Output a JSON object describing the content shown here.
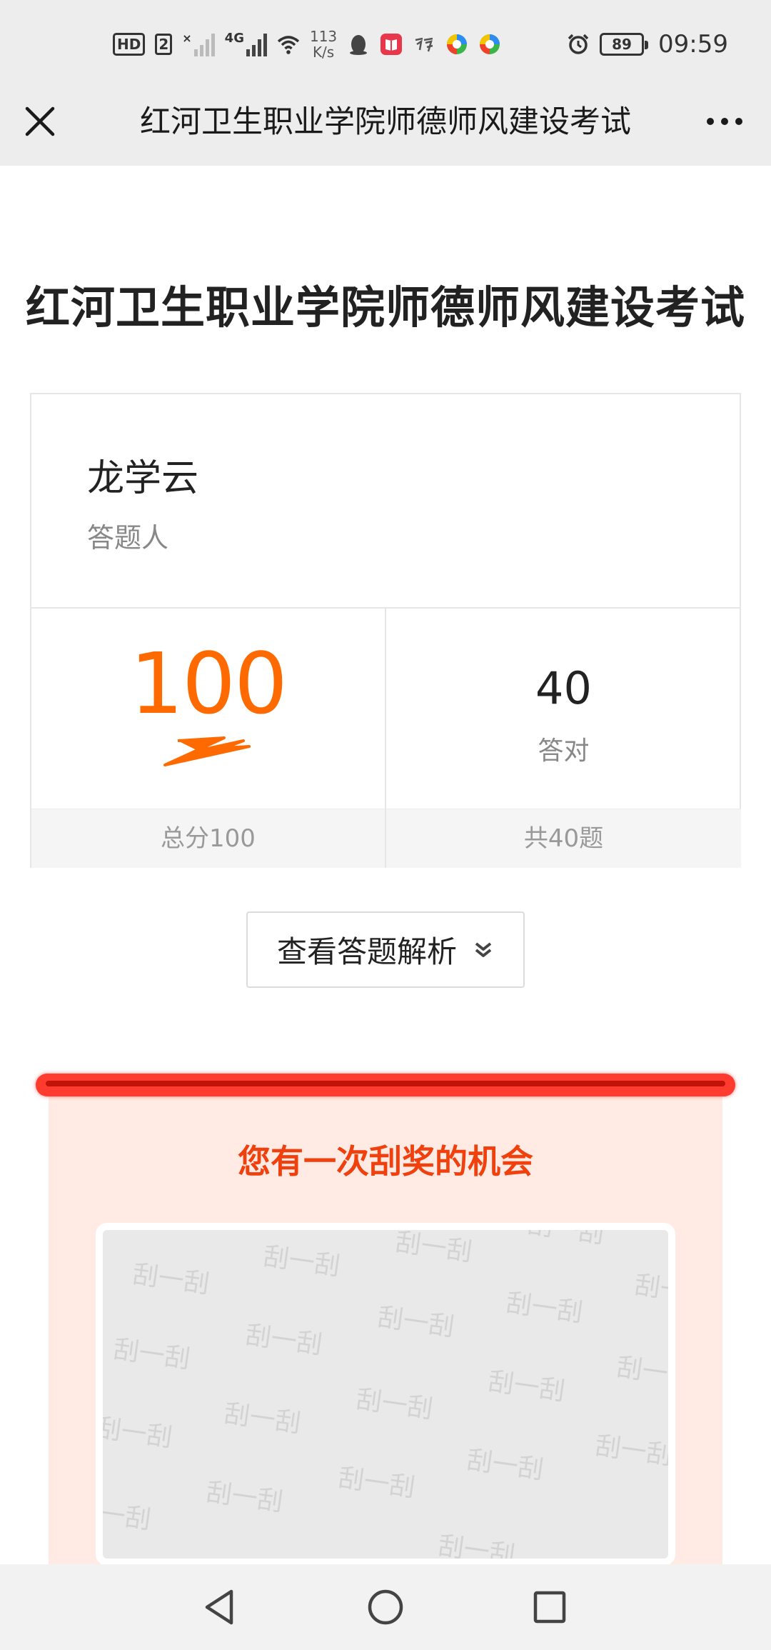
{
  "status_bar": {
    "hd_label": "HD",
    "sim_label": "2",
    "network_type": "4G",
    "speed_value": "113",
    "speed_unit": "K/s",
    "battery": "89",
    "time": "09:59"
  },
  "title_bar": {
    "title": "红河卫生职业学院师德师风建设考试"
  },
  "page": {
    "title": "红河卫生职业学院师德师风建设考试"
  },
  "result": {
    "person_name": "龙学云",
    "person_label": "答题人",
    "score": "100",
    "total_score": "总分100",
    "correct_count": "40",
    "correct_label": "答对",
    "total_questions": "共40题"
  },
  "analysis_button": {
    "label": "查看答题解析"
  },
  "scratch": {
    "title": "您有一次刮奖的机会",
    "watermark": "刮一刮"
  },
  "colors": {
    "score": "#ff6a00",
    "scratch_title": "#f0400e",
    "scratch_bg": "#ffebe3",
    "bar": "#ff3b30"
  },
  "icons": {
    "close": "close-icon",
    "more": "more-icon",
    "expand": "chevron-double-down-icon",
    "nav_back": "back-triangle-icon",
    "nav_home": "home-circle-icon",
    "nav_recent": "recent-square-icon"
  }
}
